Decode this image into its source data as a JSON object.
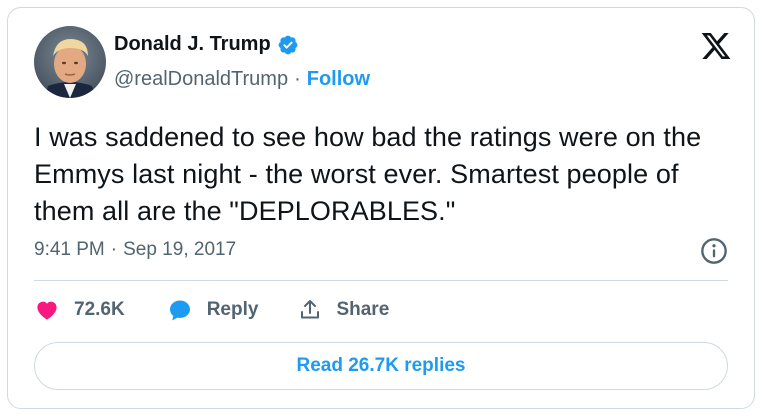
{
  "author": {
    "name": "Donald J. Trump",
    "handle": "@realDonaldTrump",
    "separator": "·",
    "follow_label": "Follow",
    "verified": true,
    "verified_color": "#1d9bf0"
  },
  "brand": {
    "logo_icon": "x-logo-icon"
  },
  "tweet": {
    "text": "I was saddened to see how bad the ratings were on the Emmys last night - the worst ever. Smartest people of them all are the \"DEPLORABLES.\"",
    "time": "9:41 PM",
    "separator": "·",
    "date": "Sep 19, 2017"
  },
  "actions": {
    "like_count": "72.6K",
    "like_color": "#f91880",
    "reply_label": "Reply",
    "reply_color": "#1d9bf0",
    "share_label": "Share"
  },
  "replies_button": {
    "label": "Read 26.7K replies"
  },
  "colors": {
    "accent": "#1d9bf0",
    "text": "#0f1419",
    "muted": "#536471",
    "border": "#cfd9de"
  }
}
